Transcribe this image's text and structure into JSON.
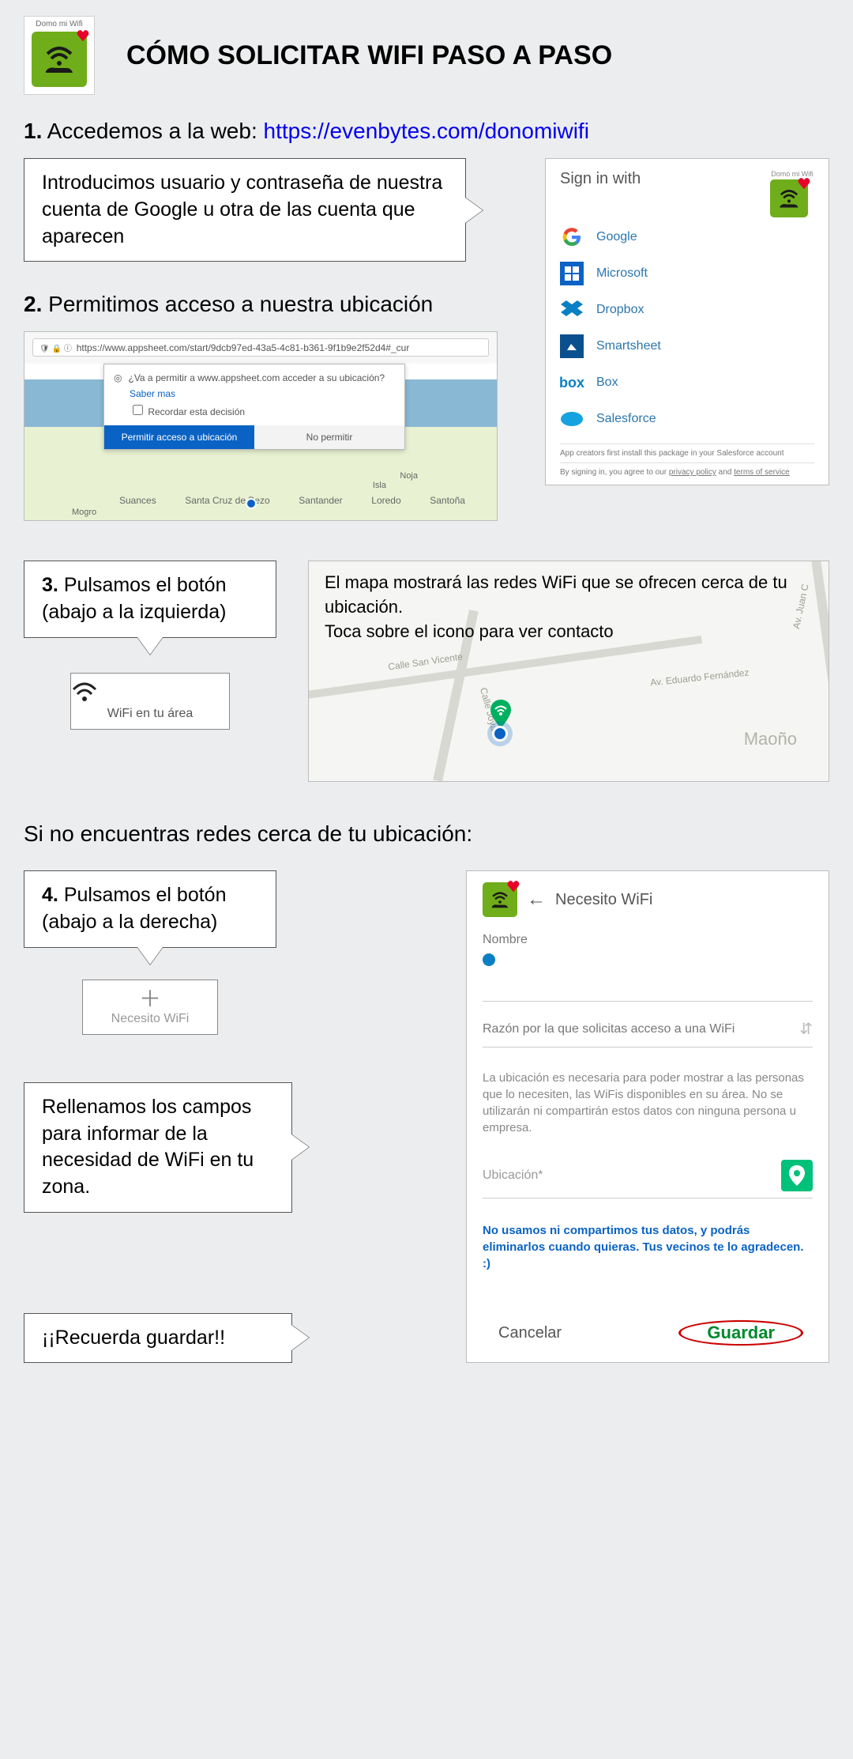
{
  "logo_label": "Domo mi Wifi",
  "title": "CÓMO SOLICITAR WIFI PASO A PASO",
  "step1": {
    "num": "1.",
    "text": "Accedemos a la web: ",
    "url": "https://evenbytes.com/donomiwifi",
    "callout": "Introducimos usuario y contraseña de nuestra cuenta de Google u otra de las cuenta que aparecen"
  },
  "signin": {
    "title": "Sign in with",
    "logo_label": "Domo mi Wifi",
    "providers": [
      "Google",
      "Microsoft",
      "Dropbox",
      "Smartsheet",
      "Box",
      "Salesforce"
    ],
    "fine1": "App creators first install this package in your Salesforce account",
    "fine2_a": "By signing in, you agree to our ",
    "fine2_b": "privacy policy",
    "fine2_c": " and ",
    "fine2_d": "terms of service"
  },
  "step2": {
    "num": "2.",
    "text": "Permitimos acceso a nuestra ubicación",
    "url": "https://www.appsheet.com/start/9dcb97ed-43a5-4c81-b361-9f1b9e2f52d4#_cur",
    "perm_q": "¿Va a permitir a www.appsheet.com acceder a su ubicación?",
    "perm_more": "Saber mas",
    "perm_remember": "Recordar esta decisión",
    "perm_allow": "Permitir acceso a ubicación",
    "perm_deny": "No permitir",
    "cities": [
      "Suances",
      "Mogro",
      "Santa Cruz de Bezo",
      "Santander",
      "Loredo",
      "Isla",
      "Noja",
      "Santoña"
    ]
  },
  "step3": {
    "num": "3.",
    "text": "Pulsamos el botón (abajo a la izquierda)",
    "btn": "WiFi en tu área",
    "map_text1": "El mapa mostrará las redes WiFi que se ofrecen cerca de tu ubicación.",
    "map_text2": "Toca sobre el icono para ver contacto",
    "streets": [
      "Calle San Vicente",
      "Av. Eduardo Fernández",
      "Calle Joya",
      "Av. Juan C"
    ],
    "town": "Maoño"
  },
  "subtitle": "Si no encuentras redes cerca de tu ubicación:",
  "step4": {
    "num": "4.",
    "text": "Pulsamos el botón (abajo a la derecha)",
    "plus_btn": "Necesito WiFi",
    "callout": "Rellenamos los campos para informar de la necesidad de WiFi en tu zona.",
    "reminder": "¡¡Recuerda guardar!!"
  },
  "form": {
    "title": "Necesito WiFi",
    "name_label": "Nombre",
    "reason_label": "Razón por la que solicitas acceso a una WiFi",
    "info": "La ubicación es necesaria para poder mostrar a las personas que lo necesiten, las WiFis disponibles en su área. No se utilizarán ni compartirán estos datos con ninguna persona u empresa.",
    "loc_label": "Ubicación*",
    "privacy": "No usamos ni compartimos tus datos, y podrás eliminarlos cuando quieras. Tus vecinos te lo agradecen. :)",
    "cancel": "Cancelar",
    "save": "Guardar"
  }
}
